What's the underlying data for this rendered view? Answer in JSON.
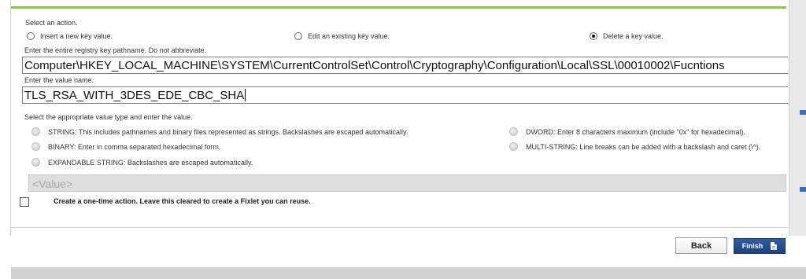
{
  "action": {
    "prompt": "Select an action.",
    "options": [
      {
        "label": "Insert a new key value.",
        "selected": false
      },
      {
        "label": "Edit an existing key value.",
        "selected": false
      },
      {
        "label": "Delete a key value.",
        "selected": true
      }
    ]
  },
  "registry_path": {
    "label": "Enter the entire registry key pathname. Do not abbreviate.",
    "value": "Computer\\HKEY_LOCAL_MACHINE\\SYSTEM\\CurrentControlSet\\Control\\Cryptography\\Configuration\\Local\\SSL\\00010002\\Fucntions"
  },
  "value_name": {
    "label": "Enter the value name.",
    "value": "TLS_RSA_WITH_3DES_EDE_CBC_SHA"
  },
  "value_type": {
    "label": "Select the appropriate value type and enter the value.",
    "options": [
      {
        "label": "STRING: This includes pathnames and binary files represented as strings. Backslashes are escaped automatically."
      },
      {
        "label": "BINARY: Enter in comma separated hexadecimal form."
      },
      {
        "label": "EXPANDABLE STRING: Backslashes are escaped automatically."
      },
      {
        "label": "DWORD: Enter 8 characters maximum (include \"0x\" for hexadecimal)."
      },
      {
        "label": "MULTI-STRING: Line breaks can be added with a backslash and caret (\\^)."
      }
    ],
    "value_placeholder": "<Value>"
  },
  "one_time": {
    "label": "Create a one-time action. Leave this cleared to create a Fixlet you can reuse.",
    "checked": false
  },
  "buttons": {
    "back": "Back",
    "finish": "Finish"
  },
  "colors": {
    "accent_bar": "#8dc63f",
    "primary_button": "#1f4a8f"
  },
  "icons": {
    "finish": "document-icon"
  }
}
